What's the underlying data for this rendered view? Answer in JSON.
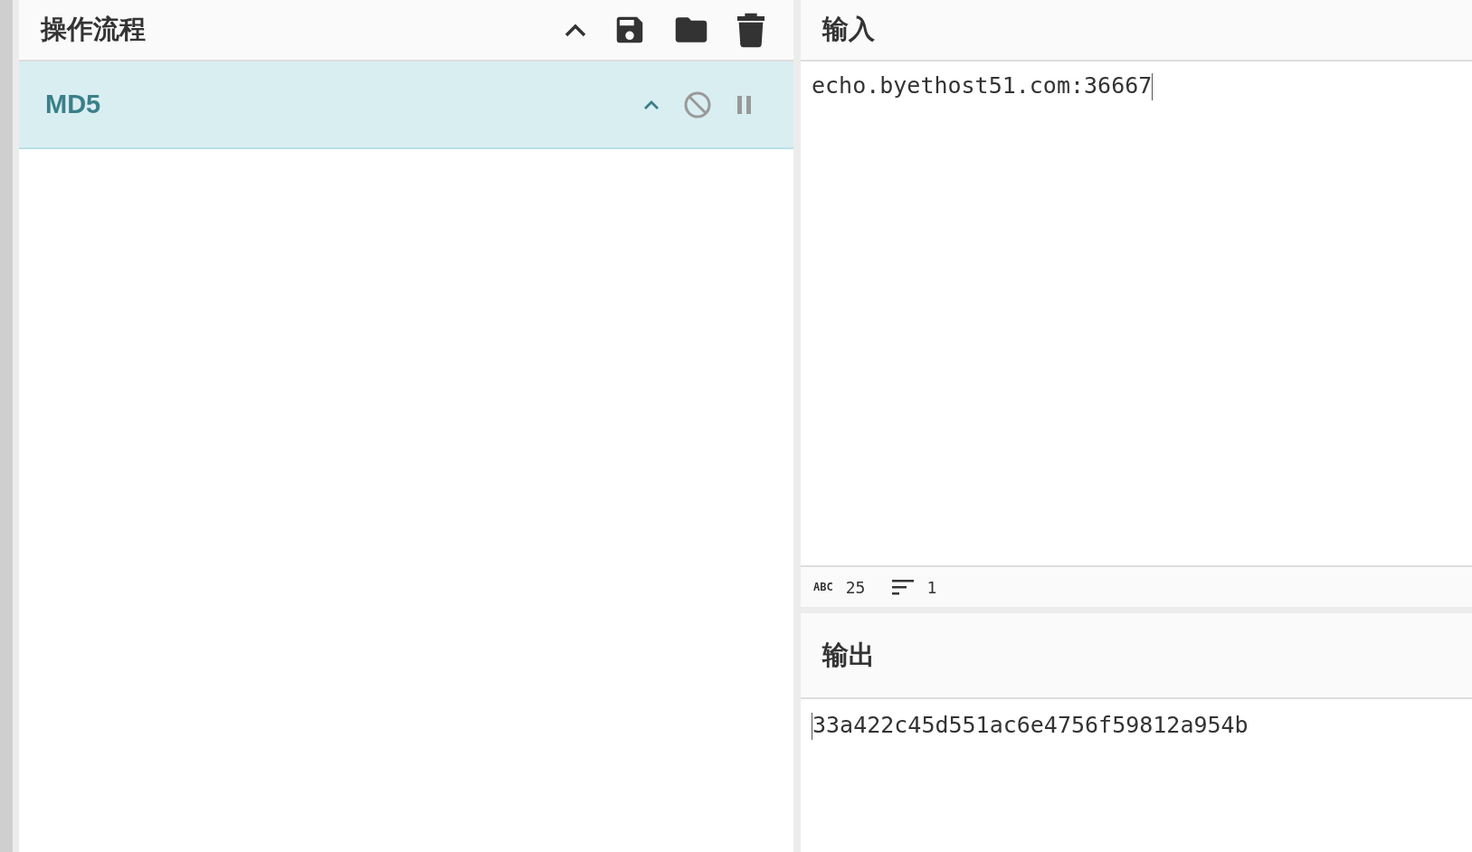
{
  "recipe": {
    "title": "操作流程",
    "operations": [
      {
        "name": "MD5",
        "disabled": false,
        "paused": false
      }
    ]
  },
  "input": {
    "title": "输入",
    "value": "echo.byethost51.com:36667"
  },
  "status_bar": {
    "type_label": "ABC",
    "length": "25",
    "lines": "1"
  },
  "output": {
    "title": "输出",
    "value": "33a422c45d551ac6e4756f59812a954b"
  }
}
